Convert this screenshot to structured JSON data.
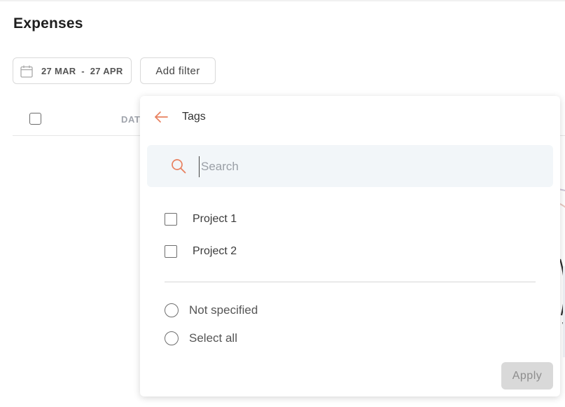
{
  "page": {
    "title": "Expenses"
  },
  "toolbar": {
    "date_range": "27 MAR  -  27 APR",
    "add_filter_label": "Add filter"
  },
  "table": {
    "columns": [
      "DATE"
    ],
    "visible_column_text": "DAT"
  },
  "filter_panel": {
    "title": "Tags",
    "search": {
      "placeholder": "Search",
      "value": ""
    },
    "options": [
      {
        "label": "Project 1",
        "checked": false
      },
      {
        "label": "Project 2",
        "checked": false
      }
    ],
    "radio_options": [
      {
        "label": "Not specified",
        "selected": false
      },
      {
        "label": "Select all",
        "selected": false
      }
    ],
    "apply_label": "Apply",
    "apply_enabled": false
  },
  "colors": {
    "accent": "#e8805f",
    "search_bg": "#f2f6f9",
    "disabled_button": "#d9d9d9"
  },
  "icons": {
    "date": "calendar-icon",
    "back": "arrow-left-icon",
    "search": "search-icon"
  }
}
